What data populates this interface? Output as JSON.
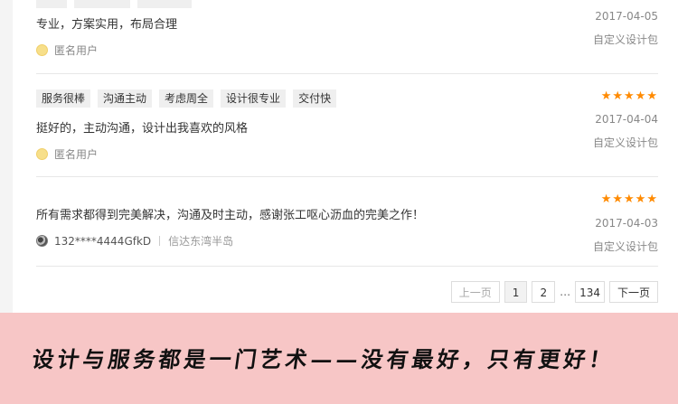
{
  "reviews": [
    {
      "tags": [
        "",
        "",
        ""
      ],
      "content": "专业，方案实用，布局合理",
      "user": "匿名用户",
      "date": "2017-04-05",
      "package": "自定义设计包"
    },
    {
      "tags": [
        "服务很棒",
        "沟通主动",
        "考虑周全",
        "设计很专业",
        "交付快"
      ],
      "stars": "★★★★★",
      "content": "挺好的，主动沟通，设计出我喜欢的风格",
      "user": "匿名用户",
      "date": "2017-04-04",
      "package": "自定义设计包"
    },
    {
      "stars": "★★★★★",
      "content": "所有需求都得到完美解决，沟通及时主动，感谢张工呕心沥血的完美之作！",
      "user": "132****4444GfkD",
      "location": "信达东湾半岛",
      "date": "2017-04-03",
      "package": "自定义设计包"
    }
  ],
  "pagination": {
    "prev": "上一页",
    "pages": [
      "1",
      "2"
    ],
    "ellipsis": "…",
    "last": "134",
    "next": "下一页"
  },
  "banner": {
    "slogan": "设计与服务都是一门艺术——没有最好，只有更好！"
  },
  "colors": {
    "star": "#ff8a00",
    "banner_bg": "#f7c6c6"
  }
}
